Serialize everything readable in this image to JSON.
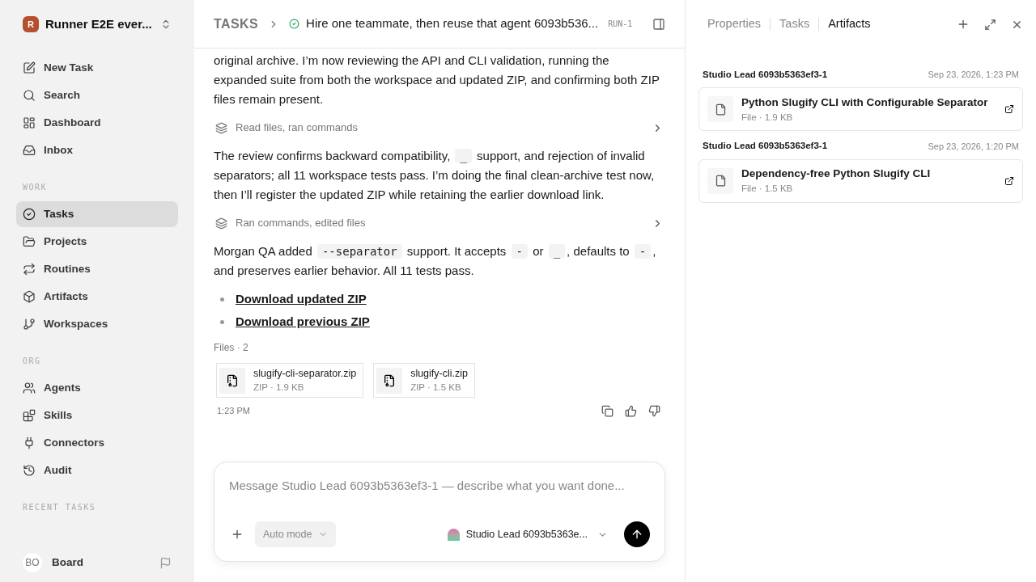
{
  "workspace": {
    "name": "Runner E2E ever...",
    "initial": "R"
  },
  "nav": [
    {
      "label": "New Task",
      "selected": false
    },
    {
      "label": "Search",
      "selected": false
    },
    {
      "label": "Dashboard",
      "selected": false
    },
    {
      "label": "Inbox",
      "selected": false
    }
  ],
  "sections": [
    {
      "title": "WORK",
      "items": [
        {
          "label": "Tasks",
          "selected": true
        },
        {
          "label": "Projects",
          "selected": false
        },
        {
          "label": "Routines",
          "selected": false
        },
        {
          "label": "Artifacts",
          "selected": false
        },
        {
          "label": "Workspaces",
          "selected": false
        }
      ]
    },
    {
      "title": "ORG",
      "items": [
        {
          "label": "Agents",
          "selected": false
        },
        {
          "label": "Skills",
          "selected": false
        },
        {
          "label": "Connectors",
          "selected": false
        },
        {
          "label": "Audit",
          "selected": false
        }
      ]
    },
    {
      "title": "RECENT TASKS"
    }
  ],
  "user": {
    "initials": "BO",
    "name": "Board"
  },
  "header": {
    "crumb": "TASKS",
    "title": "Hire one teammate, then reuse that agent 6093b536...",
    "run": "RUN-1"
  },
  "messages": [
    {
      "kind": "paragraph",
      "segments": [
        {
          "kind": "text",
          "text": "original archive. I’m now reviewing the API and CLI validation, running the expanded suite from both the workspace and updated ZIP, and confirming both ZIP files remain present."
        }
      ]
    },
    {
      "kind": "activity",
      "text": "Read files, ran commands"
    },
    {
      "kind": "paragraph",
      "segments": [
        {
          "kind": "text",
          "text": "The review confirms backward compatibility, "
        },
        {
          "kind": "code",
          "text": "_"
        },
        {
          "kind": "text",
          "text": " support, and rejection of invalid separators; all 11 workspace tests pass. I’m doing the final clean-archive test now, then I’ll register the updated ZIP while retaining the earlier download link."
        }
      ]
    },
    {
      "kind": "activity",
      "text": "Ran commands, edited files"
    },
    {
      "kind": "paragraph",
      "segments": [
        {
          "kind": "text",
          "text": "Morgan QA added "
        },
        {
          "kind": "code",
          "text": "--separator"
        },
        {
          "kind": "text",
          "text": " support. It accepts "
        },
        {
          "kind": "code",
          "text": "-"
        },
        {
          "kind": "text",
          "text": " or "
        },
        {
          "kind": "code",
          "text": "_"
        },
        {
          "kind": "text",
          "text": ", defaults to "
        },
        {
          "kind": "code",
          "text": "-"
        },
        {
          "kind": "text",
          "text": ", and preserves earlier behavior. All 11 tests pass."
        }
      ]
    },
    {
      "kind": "links",
      "items": [
        "Download updated ZIP",
        "Download previous ZIP"
      ]
    },
    {
      "kind": "files",
      "label": "Files · 2",
      "items": [
        {
          "name": "slugify-cli-separator.zip",
          "meta": "ZIP · 1.9 KB"
        },
        {
          "name": "slugify-cli.zip",
          "meta": "ZIP · 1.5 KB"
        }
      ]
    }
  ],
  "time": "1:23 PM",
  "composer": {
    "placeholder": "Message Studio Lead 6093b5363ef3-1 — describe what you want done...",
    "mode": "Auto mode",
    "agent": "Studio Lead 6093b5363e..."
  },
  "panel": {
    "tabs": [
      {
        "label": "Properties",
        "selected": false
      },
      {
        "label": "Tasks",
        "selected": false
      },
      {
        "label": "Artifacts",
        "selected": true
      }
    ],
    "artifacts": [
      {
        "author": "Studio Lead 6093b5363ef3-1",
        "date": "Sep 23, 2026, 1:23 PM",
        "title": "Python Slugify CLI with Configurable Separator",
        "meta": "File · 1.9 KB"
      },
      {
        "author": "Studio Lead 6093b5363ef3-1",
        "date": "Sep 23, 2026, 1:20 PM",
        "title": "Dependency-free Python Slugify CLI",
        "meta": "File · 1.5 KB"
      }
    ]
  }
}
